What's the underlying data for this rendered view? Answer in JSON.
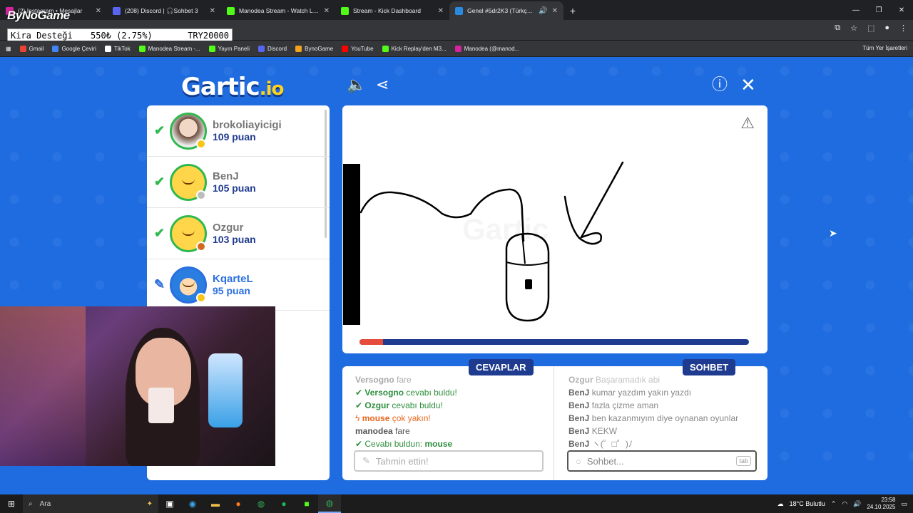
{
  "browser": {
    "tabs": [
      {
        "title": "(2) Instagram • Mesajlar",
        "color": "#d6249f"
      },
      {
        "title": "(208) Discord | 🎧Sohbet 3",
        "color": "#5865f2"
      },
      {
        "title": "Manodea Stream - Watch Live",
        "color": "#53fc18"
      },
      {
        "title": "Stream - Kick Dashboard",
        "color": "#53fc18"
      },
      {
        "title": "Genel #5dr2K3 (Türkçe) - G",
        "color": "#2a8ae0"
      }
    ],
    "bookmarks": [
      {
        "label": "Gmail",
        "color": "#ea4335"
      },
      {
        "label": "Google Çeviri",
        "color": "#4285f4"
      },
      {
        "label": "TikTok",
        "color": "#ffffff"
      },
      {
        "label": "Manodea Stream -...",
        "color": "#53fc18"
      },
      {
        "label": "Yayın Paneli",
        "color": "#53fc18"
      },
      {
        "label": "Discord",
        "color": "#5865f2"
      },
      {
        "label": "BynoGame",
        "color": "#f3a31c"
      },
      {
        "label": "YouTube",
        "color": "#ff0000"
      },
      {
        "label": "Kick Replay'den M3...",
        "color": "#53fc18"
      },
      {
        "label": "Manodea (@manod...",
        "color": "#d6249f"
      }
    ],
    "bookmarks_right": "Tüm Yer İşaretleri"
  },
  "overlay": {
    "brand": "ByNoGame",
    "ticker_label": "Kira Desteği",
    "ticker_value": "550₺ (2.75%)",
    "ticker_goal": "TRY20000"
  },
  "game": {
    "logo_main": "Gartic",
    "logo_suffix": ".io",
    "players": [
      {
        "name": "brokoliayicigi",
        "score": "109 puan",
        "status": "guessed",
        "rank_color": "#f5c518",
        "avatar": "photo"
      },
      {
        "name": "BenJ",
        "score": "105 puan",
        "status": "guessed",
        "rank_color": "#bdbdbd",
        "avatar": "default"
      },
      {
        "name": "Ozgur",
        "score": "103 puan",
        "status": "guessed",
        "rank_color": "#d2691e",
        "avatar": "default"
      },
      {
        "name": "KqarteL",
        "score": "95 puan",
        "status": "drawing",
        "rank_color": "#f5c518",
        "avatar": "blue"
      }
    ],
    "timer_fraction": 0.06,
    "answers_tab": "CEVAPLAR",
    "chat_tab": "SOHBET",
    "answers": [
      {
        "who": "Versogno",
        "text": "fare",
        "kind": "faded"
      },
      {
        "who": "Versogno",
        "text": "cevabı buldu!",
        "kind": "correct"
      },
      {
        "who": "Ozgur",
        "text": "cevabı buldu!",
        "kind": "correct"
      },
      {
        "who": "mouse",
        "text": "çok yakın!",
        "kind": "close"
      },
      {
        "who": "manodea",
        "text": "fare",
        "kind": "plain"
      },
      {
        "who": "Cevabı buldun:",
        "text": "mouse",
        "kind": "found"
      }
    ],
    "chat": [
      {
        "who": "Ozgur",
        "text": "Başaramadık abi"
      },
      {
        "who": "BenJ",
        "text": "kumar yazdım yakın yazdı"
      },
      {
        "who": "BenJ",
        "text": "fazla çizme aman"
      },
      {
        "who": "BenJ",
        "text": "ben kazanmıyım diye oynanan oyunlar"
      },
      {
        "who": "BenJ",
        "text": "KEKW"
      },
      {
        "who": "BenJ",
        "text": "ヽ(゜□゜)ﾉ"
      }
    ],
    "guess_placeholder": "Tahmin ettin!",
    "chat_placeholder": "Sohbet...",
    "tab_key": "tab"
  },
  "taskbar": {
    "search_placeholder": "Ara",
    "weather": "18°C  Bulutlu",
    "time": "23:58",
    "date": "24.10.2025"
  }
}
